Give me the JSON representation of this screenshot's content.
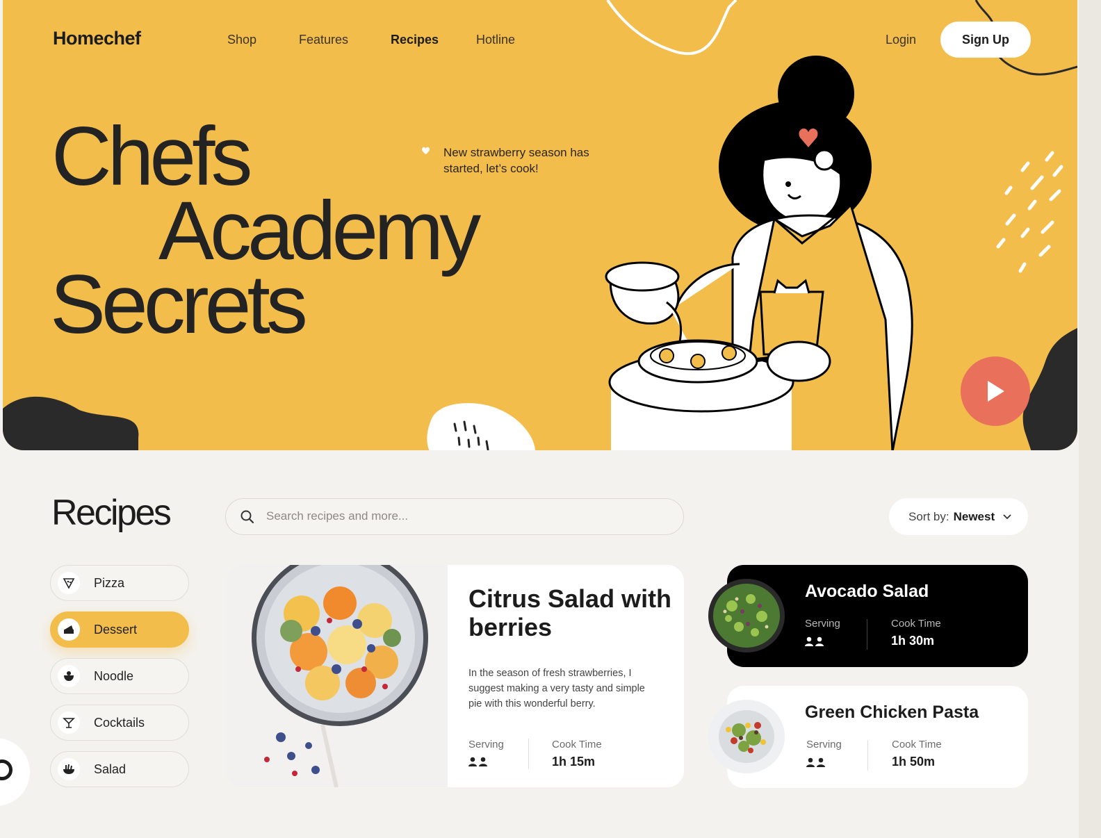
{
  "brand": {
    "logo": "Homechef"
  },
  "nav": {
    "items": [
      {
        "label": "Shop",
        "active": false
      },
      {
        "label": "Features",
        "active": false
      },
      {
        "label": "Recipes",
        "active": true
      },
      {
        "label": "Hotline",
        "active": false
      }
    ],
    "login": "Login",
    "signup": "Sign Up"
  },
  "hero": {
    "title_lines": [
      "Chefs",
      "Academy",
      "Secrets"
    ],
    "announcement": "New strawberry season has started, let’s cook!",
    "accent_color": "#f3bd4c",
    "play_color": "#e9705a"
  },
  "recipes": {
    "title": "Recipes",
    "search_placeholder": "Search recipes and more...",
    "sort_label": "Sort by:",
    "sort_value": "Newest",
    "categories": [
      {
        "label": "Pizza",
        "icon": "pizza-icon",
        "active": false
      },
      {
        "label": "Dessert",
        "icon": "cake-icon",
        "active": true
      },
      {
        "label": "Noodle",
        "icon": "bowl-icon",
        "active": false
      },
      {
        "label": "Cocktails",
        "icon": "cocktail-icon",
        "active": false
      },
      {
        "label": "Salad",
        "icon": "salad-icon",
        "active": false
      }
    ],
    "featured": {
      "title": "Citrus Salad with berries",
      "description": "In the season of fresh strawberries, I suggest making a very tasty and simple pie with this wonderful berry.",
      "serving_label": "Serving",
      "cook_time_label": "Cook Time",
      "cook_time": "1h 15m"
    },
    "cards": [
      {
        "title": "Avocado Salad",
        "serving_label": "Serving",
        "cook_time_label": "Cook Time",
        "cook_time": "1h 30m",
        "theme": "dark"
      },
      {
        "title": "Green Chicken Pasta",
        "serving_label": "Serving",
        "cook_time_label": "Cook Time",
        "cook_time": "1h 50m",
        "theme": "light"
      }
    ]
  }
}
